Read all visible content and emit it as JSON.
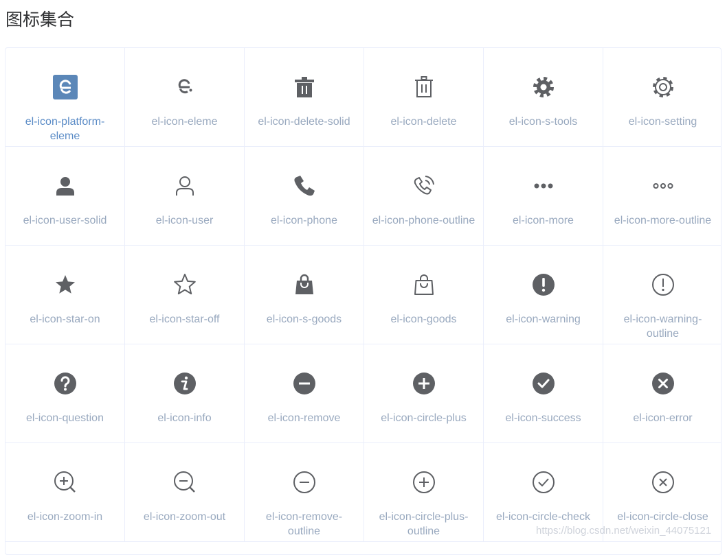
{
  "page": {
    "title": "图标集合"
  },
  "colors": {
    "icon": "#5e6064",
    "label": "#99a9bf",
    "label_active": "#5a8bc6",
    "border": "#eaeefb",
    "accent": "#5b87b8"
  },
  "icons": [
    {
      "label": "el-icon-platform-\neleme",
      "glyph": "platform-eleme-icon"
    },
    {
      "label": "el-icon-eleme",
      "glyph": "eleme-icon"
    },
    {
      "label": "el-icon-delete-solid",
      "glyph": "delete-solid-icon"
    },
    {
      "label": "el-icon-delete",
      "glyph": "delete-icon"
    },
    {
      "label": "el-icon-s-tools",
      "glyph": "s-tools-icon"
    },
    {
      "label": "el-icon-setting",
      "glyph": "setting-icon"
    },
    {
      "label": "el-icon-user-solid",
      "glyph": "user-solid-icon"
    },
    {
      "label": "el-icon-user",
      "glyph": "user-icon"
    },
    {
      "label": "el-icon-phone",
      "glyph": "phone-icon"
    },
    {
      "label": "el-icon-phone-outline",
      "glyph": "phone-outline-icon"
    },
    {
      "label": "el-icon-more",
      "glyph": "more-icon"
    },
    {
      "label": "el-icon-more-outline",
      "glyph": "more-outline-icon"
    },
    {
      "label": "el-icon-star-on",
      "glyph": "star-on-icon"
    },
    {
      "label": "el-icon-star-off",
      "glyph": "star-off-icon"
    },
    {
      "label": "el-icon-s-goods",
      "glyph": "s-goods-icon"
    },
    {
      "label": "el-icon-goods",
      "glyph": "goods-icon"
    },
    {
      "label": "el-icon-warning",
      "glyph": "warning-icon"
    },
    {
      "label": "el-icon-warning-\noutline",
      "glyph": "warning-outline-icon"
    },
    {
      "label": "el-icon-question",
      "glyph": "question-icon"
    },
    {
      "label": "el-icon-info",
      "glyph": "info-icon"
    },
    {
      "label": "el-icon-remove",
      "glyph": "remove-icon"
    },
    {
      "label": "el-icon-circle-plus",
      "glyph": "circle-plus-icon"
    },
    {
      "label": "el-icon-success",
      "glyph": "success-icon"
    },
    {
      "label": "el-icon-error",
      "glyph": "error-icon"
    },
    {
      "label": "el-icon-zoom-in",
      "glyph": "zoom-in-icon"
    },
    {
      "label": "el-icon-zoom-out",
      "glyph": "zoom-out-icon"
    },
    {
      "label": "el-icon-remove-\noutline",
      "glyph": "remove-outline-icon"
    },
    {
      "label": "el-icon-circle-plus-\noutline",
      "glyph": "circle-plus-outline-icon"
    },
    {
      "label": "el-icon-circle-check",
      "glyph": "circle-check-icon"
    },
    {
      "label": "el-icon-circle-close",
      "glyph": "circle-close-icon"
    }
  ],
  "watermark": "https://blog.csdn.net/weixin_44075121"
}
